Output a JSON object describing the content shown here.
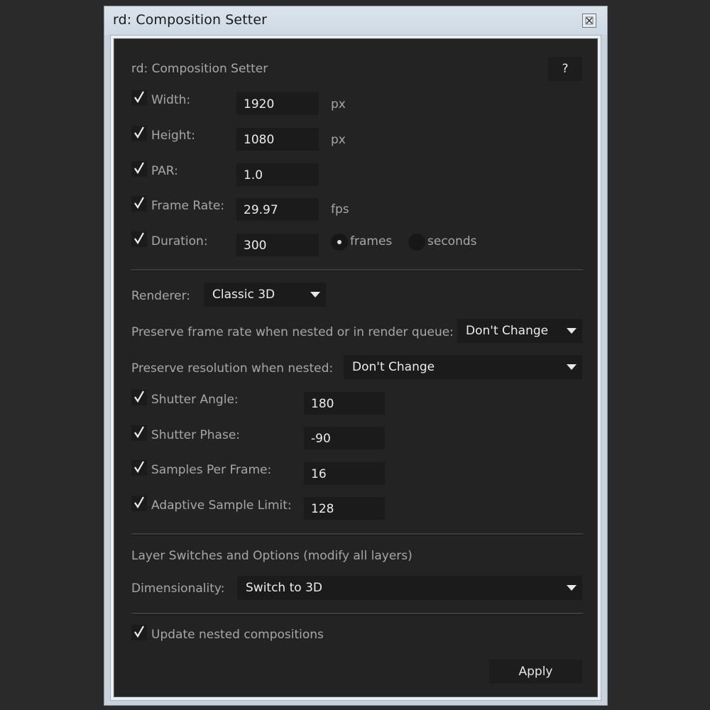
{
  "window": {
    "title": "rd: Composition Setter"
  },
  "panel": {
    "heading": "rd: Composition Setter",
    "help_label": "?"
  },
  "fields": [
    {
      "label": "Width:",
      "value": "1920",
      "unit": "px",
      "checked": true
    },
    {
      "label": "Height:",
      "value": "1080",
      "unit": "px",
      "checked": true
    },
    {
      "label": "PAR:",
      "value": "1.0",
      "unit": "",
      "checked": true
    },
    {
      "label": "Frame Rate:",
      "value": "29.97",
      "unit": "fps",
      "checked": true
    },
    {
      "label": "Duration:",
      "value": "300",
      "unit": "",
      "checked": true
    }
  ],
  "duration_units": {
    "frames": "frames",
    "seconds": "seconds",
    "selected": "frames"
  },
  "renderer": {
    "label": "Renderer:",
    "value": "Classic 3D"
  },
  "preserve_framerate": {
    "label": "Preserve frame rate when nested or in render queue:",
    "value": "Don't Change"
  },
  "preserve_resolution": {
    "label": "Preserve resolution when nested:",
    "value": "Don't Change"
  },
  "motion_blur": [
    {
      "label": "Shutter Angle:",
      "value": "180",
      "checked": true
    },
    {
      "label": "Shutter Phase:",
      "value": "-90",
      "checked": true
    },
    {
      "label": "Samples Per Frame:",
      "value": "16",
      "checked": true
    },
    {
      "label": "Adaptive Sample Limit:",
      "value": "128",
      "checked": true
    }
  ],
  "layer_section": {
    "heading": "Layer Switches and Options (modify all layers)"
  },
  "dimensionality": {
    "label": "Dimensionality:",
    "value": "Switch to 3D"
  },
  "update_nested": {
    "label": "Update nested compositions",
    "checked": true
  },
  "apply_label": "Apply",
  "colors": {
    "panel_bg": "#232323",
    "field_bg": "#1b1b1b",
    "label": "#a7a7a7",
    "titlebar": "#cfd9e3"
  }
}
